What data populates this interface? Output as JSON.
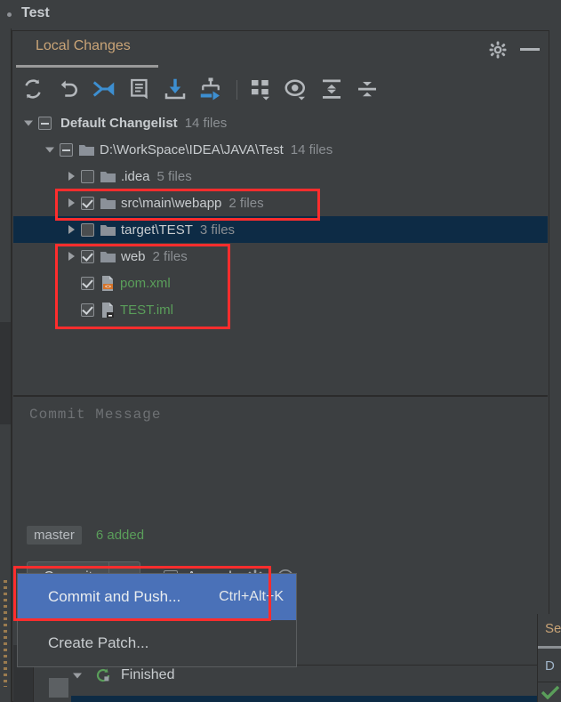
{
  "window": {
    "title": "Test",
    "dot_icon": "modified-dot-icon"
  },
  "tool_window": {
    "tab_label": "Local Changes",
    "settings_icon": "gear-icon",
    "minimize_icon": "minimize-icon"
  },
  "toolbar": {
    "buttons": [
      {
        "name": "refresh-changes-button",
        "icon": "refresh-icon"
      },
      {
        "name": "rollback-button",
        "icon": "undo-arrow-icon"
      },
      {
        "name": "show-diff-button",
        "icon": "diff-arrows-icon"
      },
      {
        "name": "edit-changelist-button",
        "icon": "note-icon"
      },
      {
        "name": "get-from-vcs-button",
        "icon": "download-icon"
      },
      {
        "name": "move-to-changelist-button",
        "icon": "move-branch-icon"
      },
      {
        "name": "group-by-button",
        "icon": "group-by-icon"
      },
      {
        "name": "preview-diff-button",
        "icon": "eye-icon"
      },
      {
        "name": "expand-all-button",
        "icon": "expand-all-icon"
      },
      {
        "name": "collapse-all-button",
        "icon": "collapse-all-icon"
      }
    ]
  },
  "tree": {
    "rows": [
      {
        "label": "Default Changelist",
        "count": "14 files",
        "indent": 0,
        "state": "partial",
        "arrow": "down",
        "kind": "changelist",
        "bold": true,
        "color": "default",
        "selected": false
      },
      {
        "label": "D:\\WorkSpace\\IDEA\\JAVA\\Test",
        "count": "14 files",
        "indent": 1,
        "state": "partial",
        "arrow": "down",
        "kind": "folder",
        "bold": false,
        "color": "default",
        "selected": false
      },
      {
        "label": ".idea",
        "count": "5 files",
        "indent": 2,
        "state": "unchecked",
        "arrow": "right",
        "kind": "folder",
        "bold": false,
        "color": "default",
        "selected": false
      },
      {
        "label": "src\\main\\webapp",
        "count": "2 files",
        "indent": 2,
        "state": "checked",
        "arrow": "right",
        "kind": "folder",
        "bold": false,
        "color": "default",
        "selected": false
      },
      {
        "label": "target\\TEST",
        "count": "3 files",
        "indent": 2,
        "state": "unchecked",
        "arrow": "right",
        "kind": "folder",
        "bold": false,
        "color": "default",
        "selected": true
      },
      {
        "label": "web",
        "count": "2 files",
        "indent": 2,
        "state": "checked",
        "arrow": "right",
        "kind": "folder",
        "bold": false,
        "color": "default",
        "selected": false
      },
      {
        "label": "pom.xml",
        "count": "",
        "indent": 2,
        "state": "checked",
        "arrow": "none",
        "kind": "xml-file",
        "bold": false,
        "color": "green",
        "selected": false
      },
      {
        "label": "TEST.iml",
        "count": "",
        "indent": 2,
        "state": "checked",
        "arrow": "none",
        "kind": "iml-file",
        "bold": false,
        "color": "green",
        "selected": false
      }
    ]
  },
  "commit": {
    "message_placeholder": "Commit Message",
    "message_value": "",
    "branch": "master",
    "added_status": "6 added",
    "commit_button_label_before": "Comm",
    "commit_button_label_mnemonic": "i",
    "commit_button_label_after": "t",
    "dropdown_icon": "chevron-down-icon",
    "amend_label": "Amend",
    "amend_checked": false,
    "settings_icon": "gear-icon",
    "history_icon": "clock-icon"
  },
  "menu": {
    "items": [
      {
        "label": "Commit and Push...",
        "shortcut": "Ctrl+Alt+K",
        "highlighted": true
      },
      {
        "label": "Create Patch...",
        "shortcut": "",
        "highlighted": false
      }
    ]
  },
  "console": {
    "finished_label": "Finished",
    "finished_icon": "green-refresh-icon",
    "expand_icon": "triangle-down-icon",
    "stop_icon": "stop-square-icon",
    "green_arrow_icon": "green-down-arrow-icon"
  },
  "right_panel": {
    "line1": "Se",
    "line2": "D",
    "check_icon": "green-check-icon"
  },
  "colors": {
    "background": "#3c3f41",
    "selection_navy": "#0d2b45",
    "menu_highlight": "#4a71b8",
    "annotation_red": "#ff2d2d",
    "added_green": "#5a9e5a",
    "tab_orange": "#c9a477",
    "accent_blue": "#3d8fd1"
  },
  "annotations": [
    {
      "name": "annotation-box-src-main-webapp"
    },
    {
      "name": "annotation-box-web-files"
    },
    {
      "name": "annotation-box-commit-and-push"
    }
  ]
}
